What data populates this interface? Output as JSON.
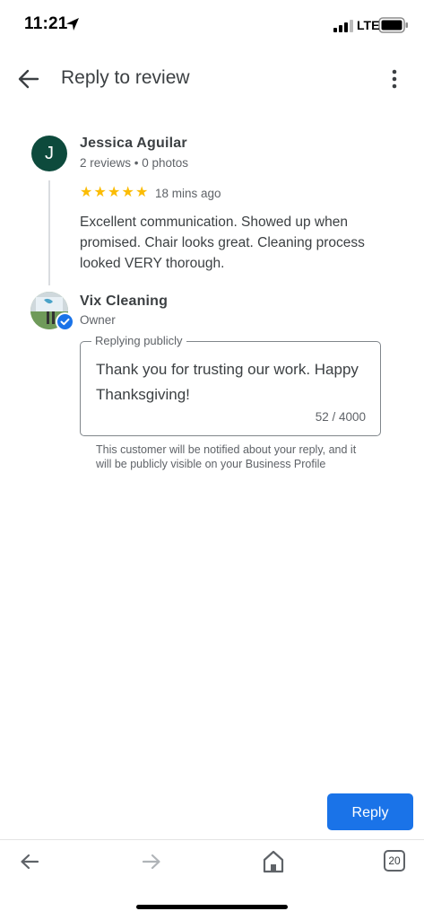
{
  "status_bar": {
    "time": "11:21",
    "network": "LTE"
  },
  "app_bar": {
    "title": "Reply to review"
  },
  "review": {
    "avatar_letter": "J",
    "avatar_color": "#0d4a3c",
    "name": "Jessica Aguilar",
    "meta": "2 reviews • 0 photos",
    "rating": 5,
    "stars": "★★★★★",
    "time": "18 mins ago",
    "text": "Excellent communication. Showed up when promised. Chair looks great. Cleaning process looked VERY thorough."
  },
  "owner": {
    "name": "Vix Cleaning",
    "role": "Owner"
  },
  "reply": {
    "legend": "Replying publicly",
    "text": "Thank you for trusting our work. Happy Thanksgiving!",
    "char_count": "52 / 4000",
    "notice": "This customer will be notified about your reply, and it will be publicly visible on your Business Profile"
  },
  "actions": {
    "reply_label": "Reply"
  },
  "browser_bar": {
    "tab_count": "20"
  },
  "colors": {
    "accent": "#1a73e8",
    "star": "#fbbc04"
  }
}
